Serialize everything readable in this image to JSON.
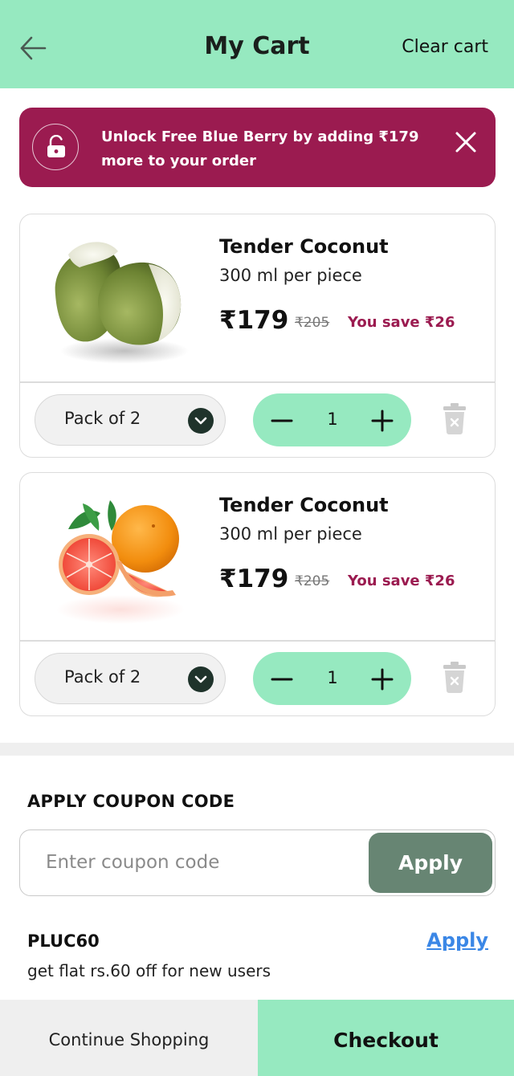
{
  "header": {
    "title": "My Cart",
    "clear_label": "Clear cart",
    "back_icon": "arrow-left-icon"
  },
  "banner": {
    "text": "Unlock Free Blue Berry by adding ₹179 more to your order",
    "lock_icon": "unlock-icon",
    "close_icon": "close-icon"
  },
  "items": [
    {
      "name": "Tender Coconut",
      "subtitle": "300 ml per piece",
      "price": "₹179",
      "mrp": "₹205",
      "savings": "You save ₹26",
      "pack": "Pack of 2",
      "quantity": "1",
      "image": "tender-coconut-image"
    },
    {
      "name": "Tender Coconut",
      "subtitle": "300 ml per piece",
      "price": "₹179",
      "mrp": "₹205",
      "savings": "You save ₹26",
      "pack": "Pack of 2",
      "quantity": "1",
      "image": "grapefruit-image"
    }
  ],
  "coupon": {
    "heading": "APPLY COUPON CODE",
    "placeholder": "Enter coupon code",
    "value": "",
    "apply_label": "Apply"
  },
  "offer": {
    "code": "PLUC60",
    "apply_label": "Apply",
    "description": "get flat rs.60 off for new users"
  },
  "footer": {
    "continue_label": "Continue Shopping",
    "checkout_label": "Checkout"
  },
  "colors": {
    "header_bg": "#96e9c0",
    "banner_bg": "#9b1b50",
    "apply_button": "#678573",
    "link": "#3b87e6",
    "savings_text": "#9b1b50"
  }
}
